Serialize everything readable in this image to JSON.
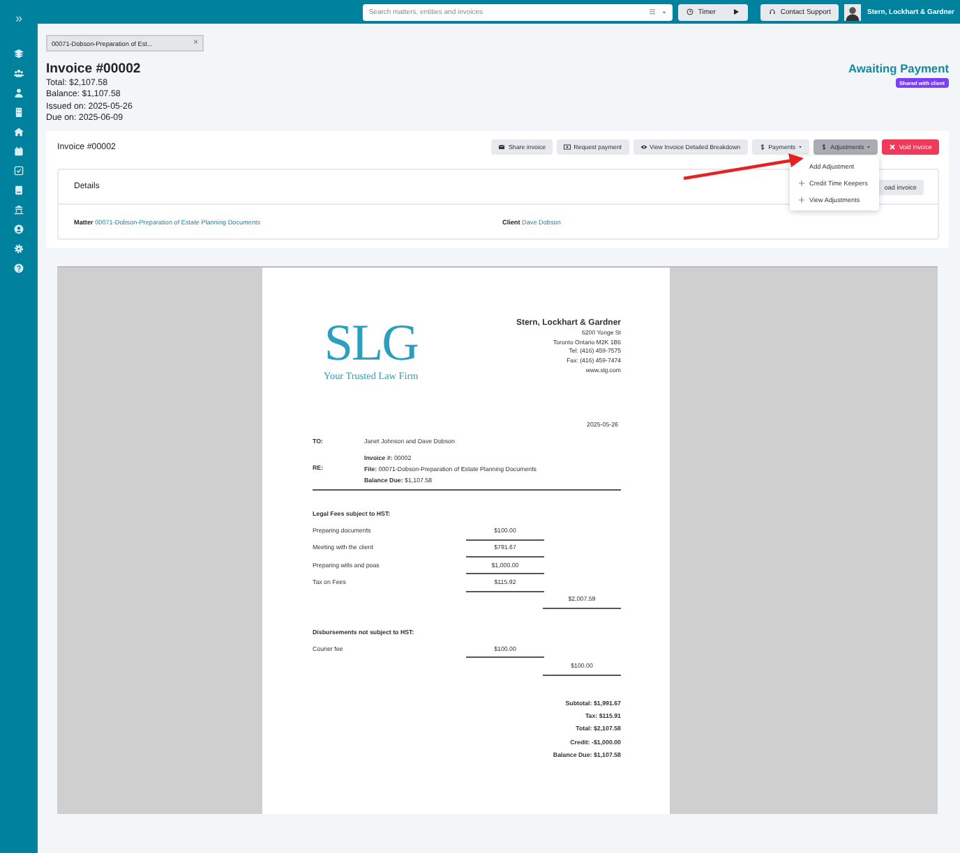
{
  "sidebar": {
    "expand": "»",
    "items": [
      {
        "kind": "layers"
      },
      {
        "kind": "people"
      },
      {
        "kind": "person"
      },
      {
        "kind": "building"
      },
      {
        "kind": "home"
      },
      {
        "kind": "calendar"
      },
      {
        "kind": "checkbox"
      },
      {
        "kind": "book"
      },
      {
        "kind": "bank"
      },
      {
        "kind": "user"
      },
      {
        "kind": "gear"
      },
      {
        "kind": "help"
      }
    ]
  },
  "topbar": {
    "search": {
      "placeholder": "Search matters, entities and invoices"
    },
    "timer": "Timer",
    "contact": "Contact Support",
    "firm": "Stern, Lockhart & Gardner"
  },
  "open_tab": {
    "label": "00071-Dobson-Preparation of Est...",
    "close": "×"
  },
  "invoice": {
    "title": "Invoice #00002",
    "lines": [
      "Total: $2,107.58",
      "Balance: $1,107.58",
      "Issued on: 2025-05-26",
      "Due on: 2025-06-09"
    ],
    "status": "Awaiting Payment",
    "badge": "Shared with client"
  },
  "toolbar": {
    "title": "Invoice #00002",
    "buttons": [
      {
        "kind": "share",
        "label": "Share invoice",
        "selected": false
      },
      {
        "kind": "request",
        "label": "Request payment",
        "selected": false
      },
      {
        "kind": "view",
        "label": "View Invoice Detailed Breakdown",
        "selected": false
      },
      {
        "kind": "payments",
        "label": "Payments",
        "selected": false
      },
      {
        "kind": "adjustments",
        "label": "Adjustments",
        "selected": true
      },
      {
        "kind": "void",
        "label": "Void Invoice",
        "selected": false
      }
    ]
  },
  "dropdown": {
    "items": [
      {
        "label": "Add Adjustment",
        "kind": "none"
      },
      {
        "label": "Credit Time Keepers",
        "kind": "plus"
      },
      {
        "label": "View Adjustments",
        "kind": "plus"
      }
    ]
  },
  "details": {
    "heading": "Details",
    "hidden_button": "oad invoice",
    "matter_label": "Matter",
    "matter": "00071-Dobson-Preparation of Estate Planning Documents",
    "client_label": "Client",
    "client": "Dave Dobson"
  },
  "document": {
    "logo": "SLG",
    "tagline": "Your Trusted Law Firm",
    "firm": "Stern, Lockhart & Gardner",
    "address": [
      "6200 Yonge St",
      "Toronto Ontario M2K 1B6",
      "Tel: (416) 459-7575",
      "Fax: (416) 459-7474",
      "www.slg.com"
    ],
    "date": "2025-05-26",
    "to_label": "TO:",
    "to": "Janet Johnson and Dave Dobson",
    "re_label": "RE:",
    "re": [
      "**Invoice #:** 00002",
      "**File:** 00071-Dobson-Preparation of Estate Planning Documents",
      "**Balance Due:** $1,107.58"
    ],
    "sections": [
      {
        "heading": "Legal Fees subject to HST:",
        "rows": [
          {
            "desc": "Preparing documents",
            "amount": "$100.00"
          },
          {
            "desc": "Meeting with the client",
            "amount": "$791.67"
          },
          {
            "desc": "Preparing wills and poas",
            "amount": "$1,000.00"
          },
          {
            "desc": "Tax on Fees",
            "amount": "$115.92"
          }
        ],
        "total": "$2,007.59"
      },
      {
        "heading": "Disbursements not subject to HST:",
        "rows": [
          {
            "desc": "Courier fee",
            "amount": "$100.00"
          }
        ],
        "total": "$100.00"
      }
    ],
    "summary": [
      "Subtotal: $1,991.67",
      "Tax: $115.91",
      "Total: $2,107.58",
      "Credit: -$1,000.00",
      "Balance Due: $1,107.58"
    ]
  }
}
